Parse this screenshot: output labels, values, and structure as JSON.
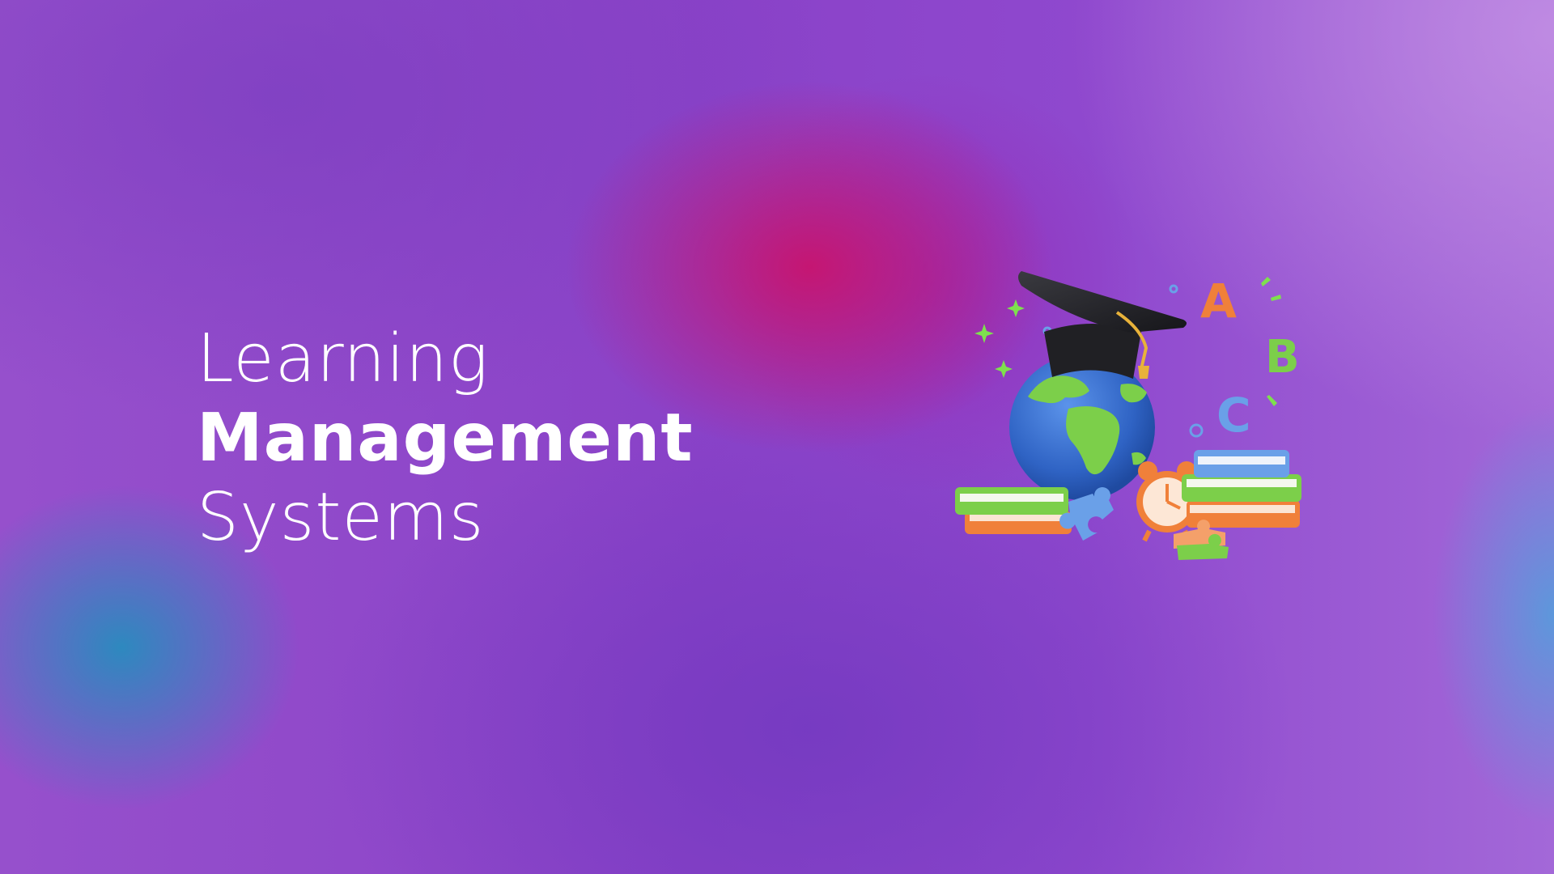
{
  "hero": {
    "title_line1": "Learning",
    "title_line2": "Management",
    "title_line3": "Systems"
  },
  "illustration": {
    "letter_a": "A",
    "letter_b": "B",
    "letter_c": "C",
    "icons": [
      "graduation-cap-icon",
      "globe-icon",
      "book-stack-icon",
      "alarm-clock-icon",
      "puzzle-piece-icon",
      "sparkle-icon"
    ]
  },
  "colors": {
    "text": "#ffffff",
    "bg_purple": "#8a42c8",
    "bg_magenta": "#c8146e",
    "bg_blue": "#288cbe",
    "book_green": "#7ccf4a",
    "book_blue": "#6aa0e8",
    "book_orange": "#f0803a",
    "globe_blue": "#3a70d0"
  }
}
